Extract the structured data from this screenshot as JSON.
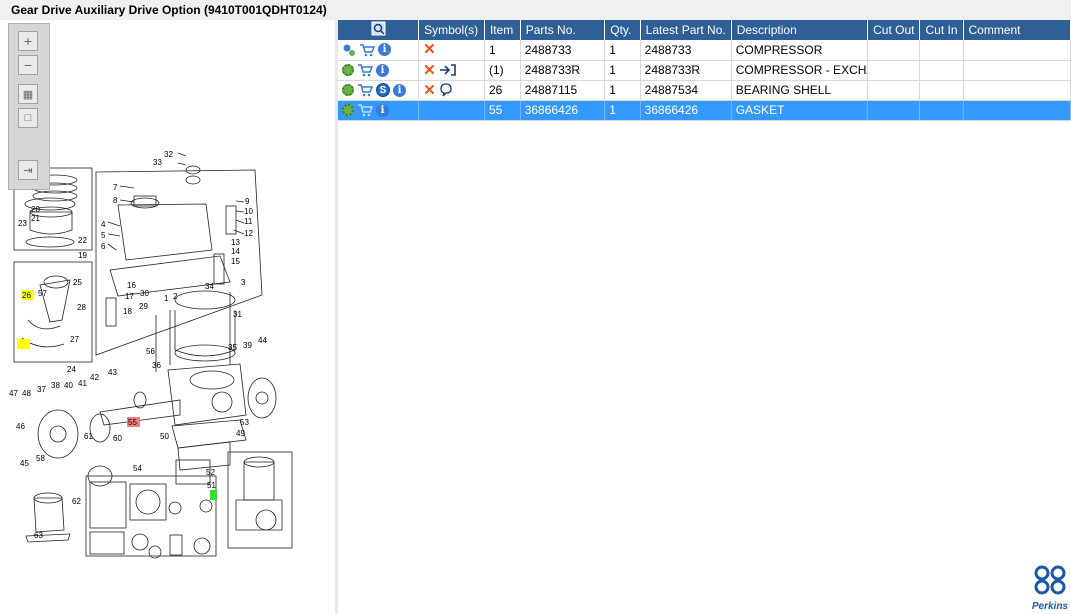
{
  "window": {
    "title": "Gear Drive Auxiliary Drive Option (9410T001QDHT0124)"
  },
  "toolbar": {
    "zoom_in_icon": "plus-icon",
    "zoom_out_icon": "minus-icon",
    "fit_icon": "fit-icon",
    "actual_size_icon": "square-icon",
    "export_icon": "export-icon"
  },
  "table": {
    "headers": {
      "search": "",
      "symbols": "Symbol(s)",
      "item": "Item",
      "parts_no": "Parts No.",
      "qty": "Qty.",
      "latest": "Latest Part No.",
      "description": "Description",
      "cut_out": "Cut Out",
      "cut_in": "Cut In",
      "comment": "Comment"
    },
    "rows": [
      {
        "item": "1",
        "parts_no": "2488733",
        "qty": "1",
        "latest": "2488733",
        "description": "COMPRESSOR",
        "cut_out": "",
        "cut_in": "",
        "comment": ""
      },
      {
        "item": "(1)",
        "parts_no": "2488733R",
        "qty": "1",
        "latest": "2488733R",
        "description": "COMPRESSOR - EXCHANG",
        "cut_out": "",
        "cut_in": "",
        "comment": ""
      },
      {
        "item": "26",
        "parts_no": "24887115",
        "qty": "1",
        "latest": "24887534",
        "description": "BEARING SHELL",
        "cut_out": "",
        "cut_in": "",
        "comment": ""
      },
      {
        "item": "55",
        "parts_no": "36866426",
        "qty": "1",
        "latest": "36866426",
        "description": "GASKET",
        "cut_out": "",
        "cut_in": "",
        "comment": ""
      }
    ]
  },
  "diagram": {
    "labels": [
      "32",
      "33",
      "7",
      "8",
      "4",
      "5",
      "6",
      "9",
      "10",
      "11",
      "12",
      "13",
      "14",
      "15",
      "3",
      "16",
      "17",
      "18",
      "30",
      "29",
      "2",
      "34",
      "31",
      "1",
      "56",
      "36",
      "35",
      "39",
      "44",
      "20",
      "21",
      "23",
      "22",
      "19",
      "26",
      "57",
      "25",
      "28",
      "27",
      "24",
      "47",
      "48",
      "46",
      "45",
      "37",
      "38",
      "40",
      "41",
      "42",
      "43",
      "55",
      "50",
      "53",
      "49",
      "61",
      "60",
      "62",
      "54",
      "63",
      "58",
      "51",
      "52"
    ],
    "highlight_yellow": [
      "26"
    ],
    "highlight_red": [
      "55"
    ],
    "highlight_green": [
      "1"
    ]
  },
  "brand": {
    "name": "Perkins"
  },
  "colors": {
    "header": "#2e5f97",
    "selected": "#3399ff",
    "highlight_yellow": "#ffff00",
    "highlight_red": "#f08080",
    "highlight_green": "#33dd33"
  }
}
